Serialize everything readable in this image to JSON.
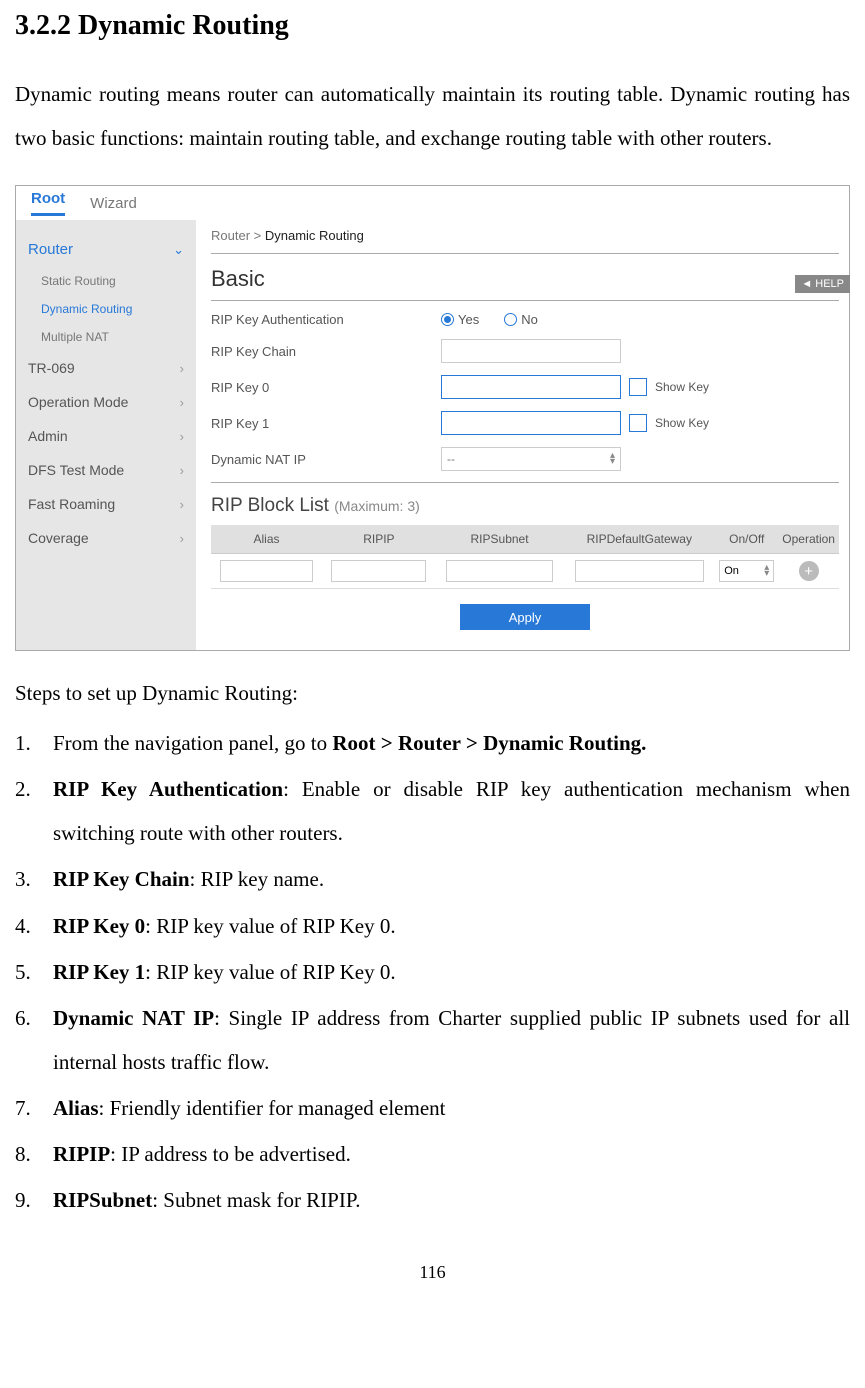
{
  "doc": {
    "section_title": "3.2.2 Dynamic Routing",
    "intro": "Dynamic routing means router can automatically maintain its routing table. Dynamic routing has two basic functions: maintain routing table, and exchange routing table with other routers.",
    "steps_intro": "Steps to set up Dynamic Routing:",
    "page_number": "116"
  },
  "screenshot": {
    "top_tabs": {
      "root": "Root",
      "wizard": "Wizard"
    },
    "help": "HELP",
    "sidebar": {
      "router": "Router",
      "sub": {
        "static": "Static Routing",
        "dynamic": "Dynamic Routing",
        "multinat": "Multiple NAT"
      },
      "tr069": "TR-069",
      "opmode": "Operation Mode",
      "admin": "Admin",
      "dfs": "DFS Test Mode",
      "fastroam": "Fast Roaming",
      "coverage": "Coverage"
    },
    "breadcrumb": {
      "router": "Router >",
      "current": "Dynamic Routing"
    },
    "basic": {
      "title": "Basic",
      "rip_auth_label": "RIP Key Authentication",
      "yes": "Yes",
      "no": "No",
      "rip_chain_label": "RIP Key Chain",
      "rip_key0_label": "RIP Key 0",
      "rip_key1_label": "RIP Key 1",
      "show_key": "Show Key",
      "dyn_nat_label": "Dynamic NAT IP",
      "dyn_nat_value": "--"
    },
    "riplist": {
      "title": "RIP Block List",
      "max": "(Maximum: 3)",
      "cols": {
        "alias": "Alias",
        "ripip": "RIPIP",
        "ripsubnet": "RIPSubnet",
        "ripgw": "RIPDefaultGateway",
        "onoff": "On/Off",
        "op": "Operation"
      },
      "on_value": "On"
    },
    "apply": "Apply"
  },
  "steps": {
    "s1_pre": "From the navigation panel, go to ",
    "s1_bold": "Root > Router > Dynamic Routing.",
    "s2_bold": "RIP Key Authentication",
    "s2_rest": ": Enable or disable RIP key authentication mechanism when switching route with other routers.",
    "s3_bold": "RIP Key Chain",
    "s3_rest": ": RIP key name.",
    "s4_bold": "RIP Key 0",
    "s4_rest": ": RIP key value of RIP Key 0.",
    "s5_bold": "RIP Key 1",
    "s5_rest": ": RIP key value of RIP Key 0.",
    "s6_bold": "Dynamic NAT IP",
    "s6_rest": ": Single IP address from Charter supplied public IP subnets used for all internal hosts traffic flow.",
    "s7_bold": "Alias",
    "s7_rest": ": Friendly identifier for managed element",
    "s8_bold": "RIPIP",
    "s8_rest": ": IP address to be advertised.",
    "s9_bold": "RIPSubnet",
    "s9_rest": ": Subnet mask for RIPIP."
  }
}
